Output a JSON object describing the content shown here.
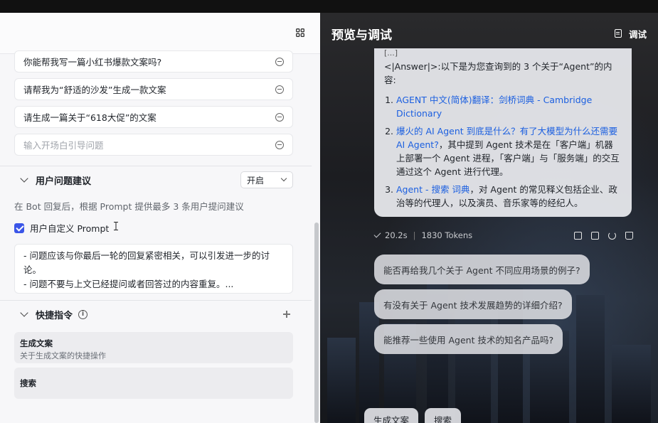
{
  "left": {
    "openers": [
      {
        "text": "你能帮我写一篇小红书爆款文案吗?"
      },
      {
        "text": "请帮我为“舒适的沙发”生成一款文案"
      },
      {
        "text": "请生成一篇关于“618大促”的文案"
      }
    ],
    "opener_placeholder": "输入开场白引导问题",
    "suggestions_section": {
      "title": "用户问题建议",
      "select_value": "开启",
      "hint": "在 Bot 回复后，根据 Prompt 提供最多 3 条用户提问建议",
      "custom_prompt_label": "用户自定义 Prompt",
      "prompt_lines": [
        "- 问题应该与你最后一轮的回复紧密相关，可以引发进一步的讨论。",
        "- 问题不要与上文已经提问或者回答过的内容重复。..."
      ]
    },
    "shortcut_section": {
      "title": "快捷指令",
      "info": "i",
      "items": [
        {
          "title": "生成文案",
          "desc": "关于生成文案的快捷操作"
        },
        {
          "title": "搜索",
          "desc": ""
        }
      ]
    }
  },
  "right": {
    "title": "预览与调试",
    "debug_label": "调试",
    "answer": {
      "cut_line": "[...]",
      "intro": "<|Answer|>:以下是为您查询到的 3 个关于“Agent”的内容:",
      "items": [
        {
          "link": "AGENT 中文(简体)翻译：剑桥词典 - Cambridge Dictionary",
          "text": ""
        },
        {
          "link": "爆火的 AI Agent 到底是什么？有了大模型为什么还需要 AI Agent?",
          "text": "，其中提到 Agent 技术是在「客户端」机器上部署一个 Agent 进程，「客户端」与「服务端」的交互通过这个 Agent 进行代理。"
        },
        {
          "link": "Agent - 搜索 词典",
          "text": "，对 Agent 的常见释义包括企业、政治等的代理人，以及演员、音乐家等的经纪人。"
        }
      ]
    },
    "meta": {
      "time": "20.2s",
      "tokens": "1830 Tokens"
    },
    "suggestions": [
      "能否再给我几个关于 Agent 不同应用场景的例子?",
      "有没有关于 Agent 技术发展趋势的详细介绍?",
      "能推荐一些使用 Agent 技术的知名产品吗?"
    ],
    "chips": [
      "生成文案",
      "搜索"
    ]
  }
}
